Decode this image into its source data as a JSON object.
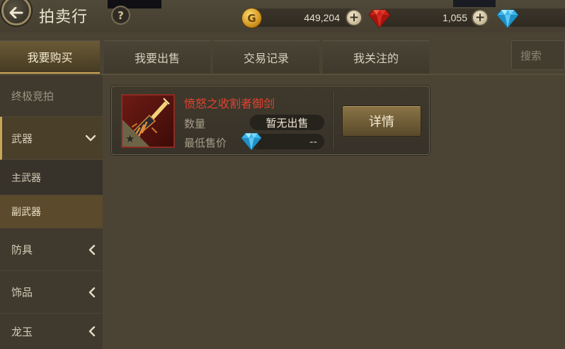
{
  "header": {
    "title": "拍卖行",
    "help_label": "?",
    "gold_amount": "449,204",
    "gold_symbol": "G",
    "red_gem_amount": "1,055",
    "plus_label": "+"
  },
  "tabs": [
    {
      "label": "我要购买",
      "active": true
    },
    {
      "label": "我要出售",
      "active": false
    },
    {
      "label": "交易记录",
      "active": false
    },
    {
      "label": "我关注的",
      "active": false
    }
  ],
  "search": {
    "placeholder": "搜索"
  },
  "sidebar": {
    "items": [
      {
        "label": "终极竞拍"
      },
      {
        "label": "武器"
      },
      {
        "label": "主武器"
      },
      {
        "label": "副武器"
      },
      {
        "label": "防具"
      },
      {
        "label": "饰品"
      },
      {
        "label": "龙玉"
      }
    ]
  },
  "listing": {
    "item_name": "愤怒之收割者御剑",
    "quantity_label": "数量",
    "quantity_value": "暂无出售",
    "min_price_label": "最低售价",
    "min_price_value": "--",
    "detail_button": "详情",
    "grade_symbol": "★"
  },
  "colors": {
    "item_name": "#e0432f",
    "accent_gold": "#c9a55a",
    "background": "#4a4334"
  },
  "icons": {
    "back": "back-arrow-icon",
    "gold": "gold-coin-icon",
    "red_gem": "red-gem-icon",
    "blue_gem": "blue-diamond-icon"
  }
}
